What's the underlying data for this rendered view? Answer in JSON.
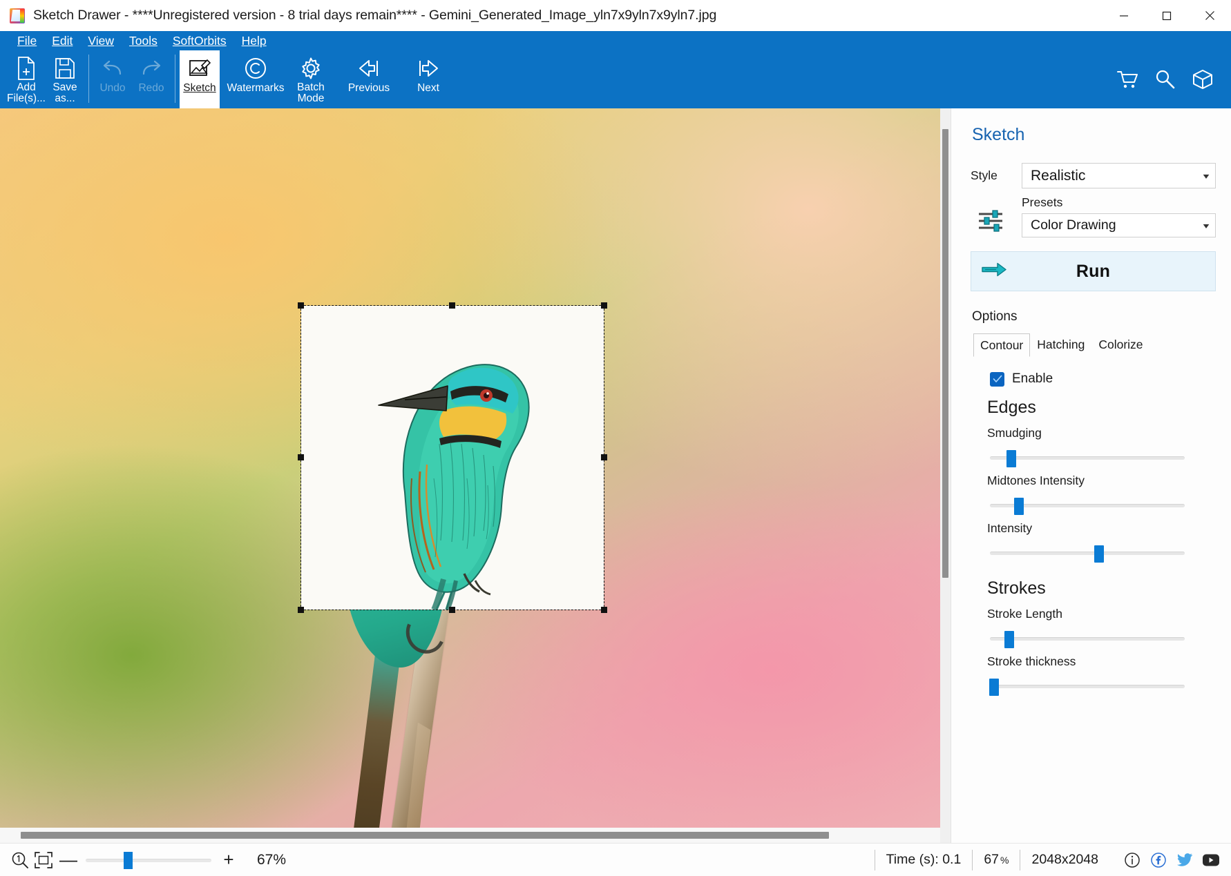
{
  "window": {
    "title": "Sketch Drawer - ****Unregistered version - 8 trial days remain**** - Gemini_Generated_Image_yln7x9yln7x9yln7.jpg",
    "minimize_label": "Minimize",
    "maximize_label": "Maximize",
    "close_label": "Close"
  },
  "menu": {
    "items": [
      {
        "label": "File"
      },
      {
        "label": "Edit"
      },
      {
        "label": "View"
      },
      {
        "label": "Tools"
      },
      {
        "label": "SoftOrbits"
      },
      {
        "label": "Help"
      }
    ]
  },
  "toolbar": {
    "buttons": [
      {
        "label_line1": "Add",
        "label_line2": "File(s)...",
        "icon": "add-file-icon",
        "state": "enabled"
      },
      {
        "label_line1": "Save",
        "label_line2": "as...",
        "icon": "save-icon",
        "state": "enabled"
      },
      {
        "label_line1": "Undo",
        "label_line2": "",
        "icon": "undo-icon",
        "state": "disabled"
      },
      {
        "label_line1": "Redo",
        "label_line2": "",
        "icon": "redo-icon",
        "state": "disabled"
      },
      {
        "label_line1": "Sketch",
        "label_line2": "",
        "icon": "sketch-icon",
        "state": "active"
      },
      {
        "label_line1": "Watermarks",
        "label_line2": "",
        "icon": "copyright-icon",
        "state": "enabled"
      },
      {
        "label_line1": "Batch",
        "label_line2": "Mode",
        "icon": "gear-icon",
        "state": "enabled"
      },
      {
        "label_line1": "Previous",
        "label_line2": "",
        "icon": "arrow-left-icon",
        "state": "enabled"
      },
      {
        "label_line1": "Next",
        "label_line2": "",
        "icon": "arrow-right-icon",
        "state": "enabled"
      }
    ],
    "right_icons": [
      {
        "name": "cart-icon"
      },
      {
        "name": "key-icon"
      },
      {
        "name": "box-icon"
      }
    ]
  },
  "panel": {
    "title": "Sketch",
    "style_label": "Style",
    "style_value": "Realistic",
    "presets_label": "Presets",
    "presets_value": "Color Drawing",
    "sliders_icon": "sliders-icon",
    "run_label": "Run",
    "run_icon": "run-arrow-icon",
    "options_label": "Options",
    "tabs": [
      {
        "label": "Contour",
        "active": true
      },
      {
        "label": "Hatching",
        "active": false
      },
      {
        "label": "Colorize",
        "active": false
      }
    ],
    "enable_label": "Enable",
    "enable_checked": true,
    "sections": [
      {
        "heading": "Edges",
        "sliders": [
          {
            "label": "Smudging",
            "value_pct": 11
          },
          {
            "label": "Midtones Intensity",
            "value_pct": 15
          },
          {
            "label": "Intensity",
            "value_pct": 56
          }
        ]
      },
      {
        "heading": "Strokes",
        "sliders": [
          {
            "label": "Stroke Length",
            "value_pct": 10
          },
          {
            "label": "Stroke thickness",
            "value_pct": 2
          }
        ]
      }
    ]
  },
  "statusbar": {
    "zoom_reset_icon": "zoom-actual-size-icon",
    "fit_icon": "fit-to-window-icon",
    "zoom_out_label": "—",
    "zoom_in_label": "+",
    "zoom_slider_pct": 30,
    "zoom_label": "67%",
    "time_label": "Time (s): 0.1",
    "scale_value": "67",
    "scale_unit": "%",
    "dimensions": "2048x2048",
    "social_icons": [
      {
        "name": "info-icon"
      },
      {
        "name": "facebook-icon"
      },
      {
        "name": "twitter-icon"
      },
      {
        "name": "youtube-icon"
      }
    ]
  }
}
